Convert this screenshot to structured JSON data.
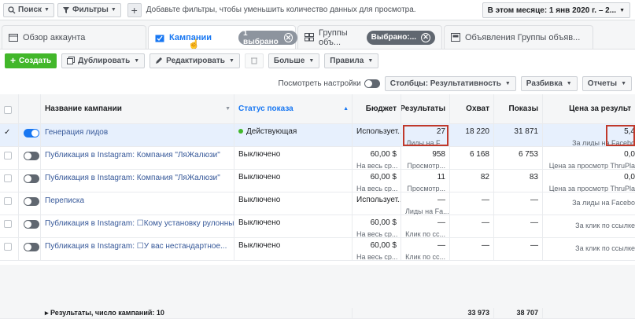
{
  "filterbar": {
    "search": "Поиск",
    "filters": "Фильтры",
    "hint": "Добавьте фильтры, чтобы уменьшить количество данных для просмотра.",
    "date": "В этом месяце: 1 янв 2020 г. – 2..."
  },
  "tabs": {
    "overview": "Обзор аккаунта",
    "campaigns": "Кампании",
    "campaigns_pill": "1 выбрано",
    "adsets": "Группы объ...",
    "adsets_pill": "Выбрано:...",
    "ads": "Объявления Группы объяв..."
  },
  "toolbar": {
    "create": "Создать",
    "duplicate": "Дублировать",
    "edit": "Редактировать",
    "more": "Больше",
    "rules": "Правила",
    "view_settings": "Посмотреть настройки",
    "columns": "Столбцы: Результативность",
    "breakdown": "Разбивка",
    "reports": "Отчеты"
  },
  "columns": {
    "name": "Название кампании",
    "status": "Статус показа",
    "budget": "Бюджет",
    "results": "Результаты",
    "reach": "Охват",
    "impressions": "Показы",
    "cost": "Цена за результ"
  },
  "rows": [
    {
      "name": "Генерация лидов",
      "status": "Действующая",
      "active": true,
      "budget": "Использует...",
      "budget_sub": "",
      "results": "27",
      "results_sub": "Лиды на F...",
      "reach": "18 220",
      "impressions": "31 871",
      "cost": "5,4",
      "cost_sub": "За лиды на Facebo"
    },
    {
      "name": "Публикация в Instagram: Компания \"ЛяЖалюзи\"",
      "status": "Выключено",
      "active": false,
      "budget": "60,00 $",
      "budget_sub": "На весь ср...",
      "results": "958",
      "results_sub": "Просмотр...",
      "reach": "6 168",
      "impressions": "6 753",
      "cost": "0,0",
      "cost_sub": "Цена за просмотр ThruPla"
    },
    {
      "name": "Публикация в Instagram: Компания \"ЛяЖалюзи\"",
      "status": "Выключено",
      "active": false,
      "budget": "60,00 $",
      "budget_sub": "На весь ср...",
      "results": "11",
      "results_sub": "Просмотр...",
      "reach": "82",
      "impressions": "83",
      "cost": "0,0",
      "cost_sub": "Цена за просмотр ThruPla"
    },
    {
      "name": "Переписка",
      "status": "Выключено",
      "active": false,
      "budget": "Использует...",
      "budget_sub": "",
      "results": "—",
      "results_sub": "Лиды на Fa...",
      "reach": "—",
      "impressions": "—",
      "cost": "",
      "cost_sub": "За лиды на Facebo"
    },
    {
      "name": "Публикация в Instagram: ☐Кому установку рулонных...",
      "status": "Выключено",
      "active": false,
      "budget": "60,00 $",
      "budget_sub": "На весь ср...",
      "results": "—",
      "results_sub": "Клик по сс...",
      "reach": "—",
      "impressions": "—",
      "cost": "",
      "cost_sub": "За клик по ссылке"
    },
    {
      "name": "Публикация в Instagram: ☐У вас нестандартное...",
      "status": "Выключено",
      "active": false,
      "budget": "60,00 $",
      "budget_sub": "На весь ср...",
      "results": "—",
      "results_sub": "Клик по сс...",
      "reach": "—",
      "impressions": "—",
      "cost": "",
      "cost_sub": "За клик по ссылке"
    }
  ],
  "footer": {
    "label": "Результаты, число кампаний: 10",
    "reach": "33 973",
    "impressions": "38 707"
  },
  "colors": {
    "accent": "#1877f2",
    "green": "#42b72a",
    "highlight": "#c0392b"
  }
}
